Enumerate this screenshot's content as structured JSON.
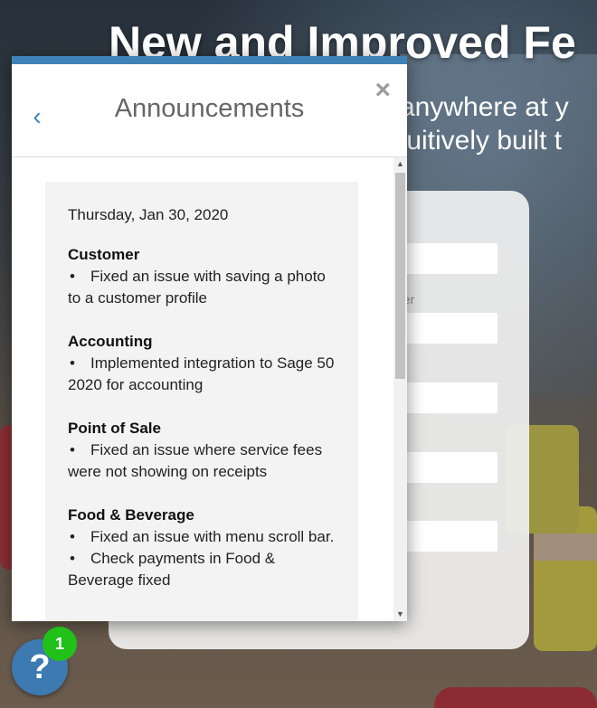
{
  "hero": {
    "title": "New and Improved Fe",
    "subtitle_line1": "anywhere at y",
    "subtitle_line2": "tuitively built t"
  },
  "form": {
    "partial_label": "ber"
  },
  "modal": {
    "title": "Announcements",
    "back_icon": "‹",
    "close_icon": "×",
    "date": "Thursday, Jan 30, 2020",
    "sections": [
      {
        "heading": "Customer",
        "items": [
          "Fixed an issue with saving a photo to a customer profile"
        ]
      },
      {
        "heading": "Accounting",
        "items": [
          "Implemented integration to Sage 50 2020 for accounting"
        ]
      },
      {
        "heading": "Point of Sale",
        "items": [
          "Fixed an issue where service fees were not showing on receipts"
        ]
      },
      {
        "heading": "Food & Beverage",
        "items": [
          "Fixed an issue with menu scroll bar.",
          "Check payments in Food & Beverage fixed"
        ]
      }
    ]
  },
  "help": {
    "icon": "?",
    "badge_count": "1"
  },
  "colors": {
    "accent": "#3f83b6",
    "badge": "#22c11a"
  }
}
